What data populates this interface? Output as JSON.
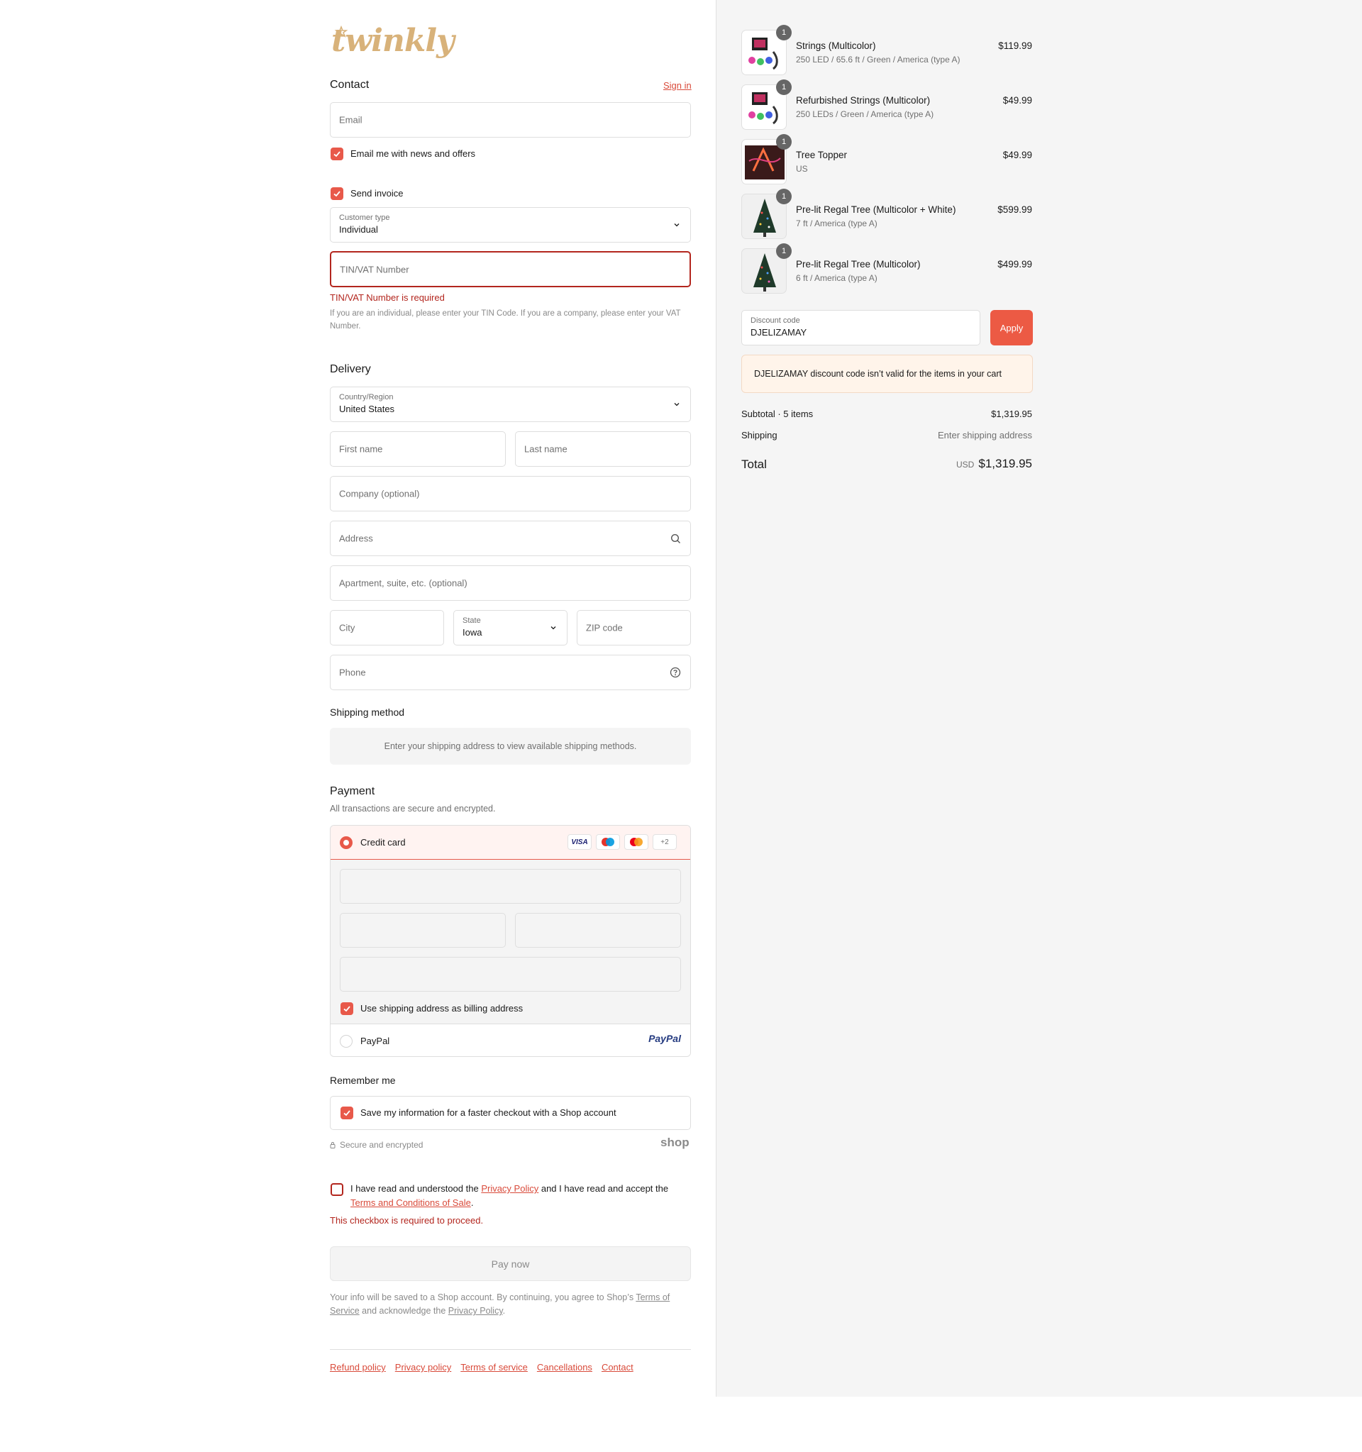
{
  "brand": {
    "logo_text": "twinkly",
    "accent_color": "#e8594a",
    "error_color": "#b3261e"
  },
  "contact": {
    "heading": "Contact",
    "sign_in": "Sign in",
    "email_placeholder": "Email",
    "news_label": "Email me with news and offers",
    "send_invoice_label": "Send invoice",
    "customer_type_label": "Customer type",
    "customer_type_value": "Individual",
    "tin_placeholder": "TIN/VAT Number",
    "tin_error": "TIN/VAT Number is required",
    "tin_help": "If you are an individual, please enter your TIN Code. If you are a company, please enter your VAT Number."
  },
  "delivery": {
    "heading": "Delivery",
    "country_label": "Country/Region",
    "country_value": "United States",
    "first_name": "First name",
    "last_name": "Last name",
    "company": "Company (optional)",
    "address": "Address",
    "apartment": "Apartment, suite, etc. (optional)",
    "city": "City",
    "state_label": "State",
    "state_value": "Iowa",
    "zip": "ZIP code",
    "phone": "Phone"
  },
  "shipping_method": {
    "heading": "Shipping method",
    "message": "Enter your shipping address to view available shipping methods."
  },
  "payment": {
    "heading": "Payment",
    "subtitle": "All transactions are secure and encrypted.",
    "credit_card_label": "Credit card",
    "card_badges": [
      "VISA",
      "+2"
    ],
    "billing_same_label": "Use shipping address as billing address",
    "paypal_label": "PayPal",
    "paypal_logo": "PayPal"
  },
  "remember": {
    "heading": "Remember me",
    "save_label": "Save my information for a faster checkout with a Shop account",
    "secure_label": "Secure and encrypted",
    "shop_logo": "shop"
  },
  "terms": {
    "text_1": "I have read and understood the ",
    "privacy_link": "Privacy Policy",
    "text_2": " and I have read and accept the ",
    "terms_link": "Terms and Conditions of Sale",
    "text_3": ".",
    "error": "This checkbox is required to proceed."
  },
  "pay_now": "Pay now",
  "shop_notice": {
    "text_1": "Your info will be saved to a Shop account. By continuing, you agree to Shop’s ",
    "terms_link": "Terms of Service",
    "text_2": " and acknowledge the ",
    "privacy_link": "Privacy Policy",
    "text_3": "."
  },
  "footer_links": [
    "Refund policy",
    "Privacy policy",
    "Terms of service",
    "Cancellations",
    "Contact"
  ],
  "cart": {
    "items": [
      {
        "qty": "1",
        "name": "Strings (Multicolor)",
        "variant": "250 LED / 65.6 ft / Green / America (type A)",
        "price": "$119.99",
        "thumb": "strings-image"
      },
      {
        "qty": "1",
        "name": "Refurbished Strings (Multicolor)",
        "variant": "250 LEDs / Green / America (type A)",
        "price": "$49.99",
        "thumb": "strings-image"
      },
      {
        "qty": "1",
        "name": "Tree Topper",
        "variant": "US",
        "price": "$49.99",
        "thumb": "topper-image"
      },
      {
        "qty": "1",
        "name": "Pre-lit Regal Tree (Multicolor + White)",
        "variant": "7 ft / America (type A)",
        "price": "$599.99",
        "thumb": "tree-image"
      },
      {
        "qty": "1",
        "name": "Pre-lit Regal Tree (Multicolor)",
        "variant": "6 ft / America (type A)",
        "price": "$499.99",
        "thumb": "tree-image"
      }
    ],
    "discount_label": "Discount code",
    "discount_value": "DJELIZAMAY",
    "apply": "Apply",
    "discount_notice": "DJELIZAMAY discount code isn’t valid for the items in your cart",
    "subtotal_label": "Subtotal · 5 items",
    "subtotal_value": "$1,319.95",
    "shipping_label": "Shipping",
    "shipping_value": "Enter shipping address",
    "total_label": "Total",
    "currency": "USD",
    "total_value": "$1,319.95"
  }
}
